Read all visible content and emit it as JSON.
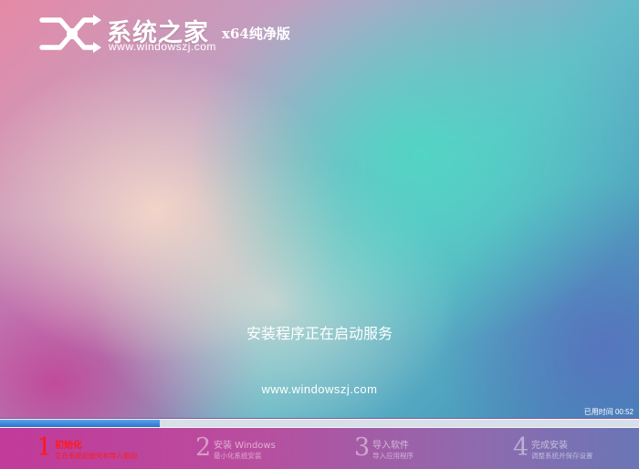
{
  "branding": {
    "title": "系统之家",
    "edition": "x64纯净版",
    "url": "www.windowszj.com"
  },
  "status": {
    "message": "安装程序正在启动服务",
    "site_url": "www.windowszj.com",
    "elapsed_label": "已用时间",
    "elapsed_value": "00:52"
  },
  "progress": {
    "fraction": 0.25,
    "color": "#3a86d8"
  },
  "steps": [
    {
      "number": "1",
      "title": "初始化",
      "subtitle": "正在系统初始化和导入驱动",
      "active": true
    },
    {
      "number": "2",
      "title": "安装 Windows",
      "subtitle": "最小化系统安装",
      "active": false
    },
    {
      "number": "3",
      "title": "导入软件",
      "subtitle": "导入应用程序",
      "active": false
    },
    {
      "number": "4",
      "title": "完成安装",
      "subtitle": "调整系统并保存设置",
      "active": false
    }
  ],
  "colors": {
    "active_step": "#ff1a1a",
    "inactive_step": "#f0d8ee"
  }
}
